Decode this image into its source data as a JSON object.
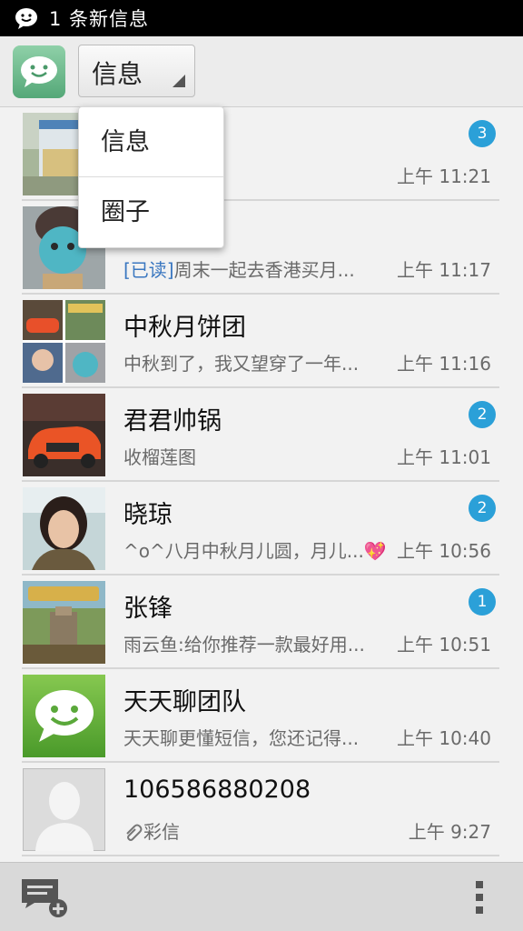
{
  "status_bar": {
    "notification_text": "1 条新信息"
  },
  "header": {
    "spinner_label": "信息"
  },
  "dropdown": {
    "items": [
      {
        "label": "信息"
      },
      {
        "label": "圈子"
      }
    ]
  },
  "conversations": [
    {
      "name": "",
      "preview": "",
      "time": "上午 11:21",
      "badge": "3",
      "avatar": "drink-photo"
    },
    {
      "name": "",
      "read_tag": "[已读]",
      "preview": "周末一起去香港买月...",
      "time": "上午 11:17",
      "badge": "",
      "avatar": "mask-photo"
    },
    {
      "name": "中秋月饼团",
      "preview": "中秋到了，我又望穿了一年...",
      "time": "上午 11:16",
      "badge": "",
      "avatar": "group-collage"
    },
    {
      "name": "君君帅锅",
      "preview": "收榴莲图",
      "time": "上午 11:01",
      "badge": "2",
      "avatar": "car-photo"
    },
    {
      "name": "晓琼",
      "preview": "^o^八月中秋月儿圆，月儿...💖",
      "time": "上午 10:56",
      "badge": "2",
      "avatar": "woman-photo"
    },
    {
      "name": "张锋",
      "preview": "雨云鱼:给你推荐一款最好用...",
      "time": "上午 10:51",
      "badge": "1",
      "avatar": "robots-game"
    },
    {
      "name": "天天聊团队",
      "preview": "天天聊更懂短信，您还记得...",
      "time": "上午 10:40",
      "badge": "",
      "avatar": "chat-bubble-logo"
    },
    {
      "name": "106586880208",
      "preview": "彩信",
      "time": "上午 9:27",
      "badge": "",
      "avatar": "default-contact"
    }
  ],
  "colors": {
    "badge": "#2ba0d8",
    "read_tag": "#3a77c0",
    "app_green": "#55a878"
  }
}
